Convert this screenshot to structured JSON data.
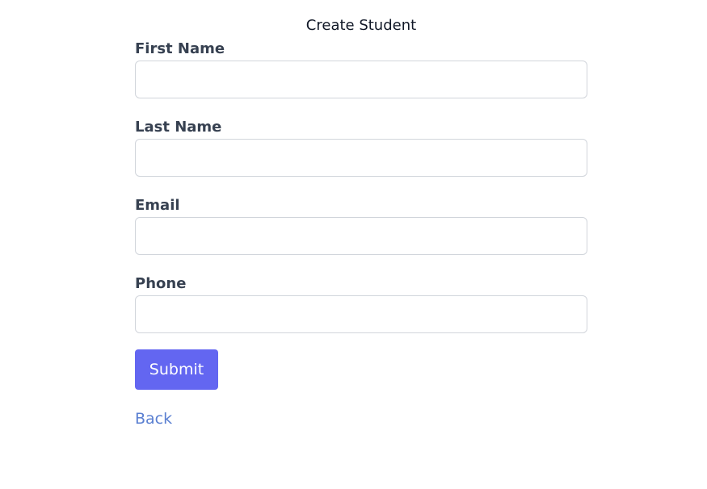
{
  "page": {
    "title": "Create Student"
  },
  "form": {
    "fields": [
      {
        "label": "First Name",
        "value": "",
        "placeholder": ""
      },
      {
        "label": "Last Name",
        "value": "",
        "placeholder": ""
      },
      {
        "label": "Email",
        "value": "",
        "placeholder": ""
      },
      {
        "label": "Phone",
        "value": "",
        "placeholder": ""
      }
    ],
    "submit_label": "Submit",
    "back_label": "Back"
  },
  "colors": {
    "primary": "#6366f1",
    "link": "#5a7fd1",
    "label": "#374151",
    "input_border": "#d1d5db"
  }
}
